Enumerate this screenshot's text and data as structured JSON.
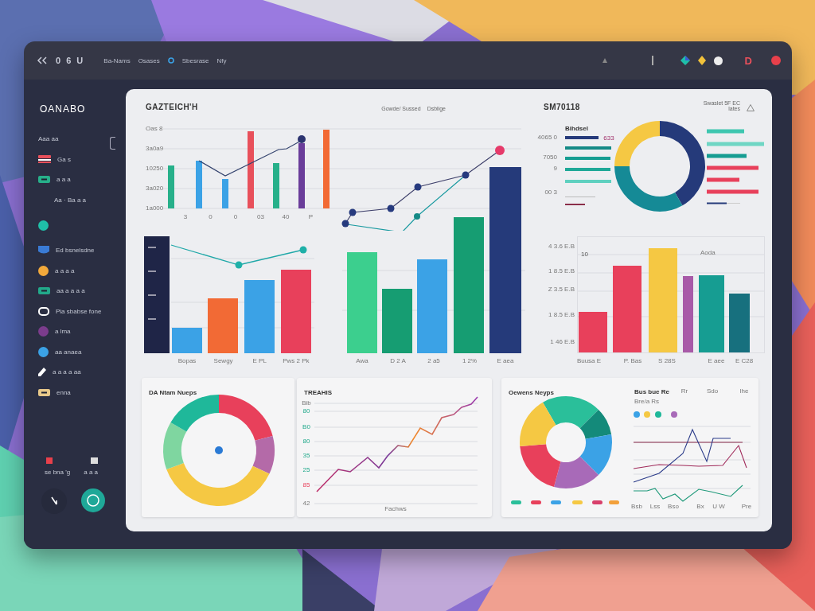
{
  "topbar": {
    "title": "0 6 U",
    "menu": [
      {
        "label": "Ba-Nams"
      },
      {
        "label": "Osases"
      },
      {
        "label": "Sbesrase"
      },
      {
        "label": "Nfy"
      }
    ],
    "avatar_letter": "D"
  },
  "sidebar": {
    "brand": "OANABO",
    "items": [
      {
        "label": "Aaa aa"
      },
      {
        "label": "Ga s",
        "kind": "stripes",
        "color": "#e8505b"
      },
      {
        "label": "a a a",
        "kind": "rect",
        "color": "#27b08a"
      },
      {
        "label": "Aa · Ba a a",
        "kind": "indent"
      },
      {
        "kind": "circle",
        "color": "#1fbfa8"
      },
      {
        "label": "Ed bsnelsdne",
        "kind": "shield",
        "color": "#3a7bd5"
      },
      {
        "label": "a a a a",
        "kind": "circle",
        "color": "#f2a93b"
      },
      {
        "label": "aa a a a a",
        "kind": "rect",
        "color": "#22a98a"
      },
      {
        "label": "Pia sbabse fone",
        "kind": "ring",
        "color": "#ffffff"
      },
      {
        "label": "a lma",
        "kind": "circle",
        "color": "#7b3c8c"
      },
      {
        "label": "aa anaea",
        "kind": "circle",
        "color": "#3ba2e6"
      },
      {
        "label": "a a a a aa",
        "kind": "pen",
        "color": "#ffffff"
      },
      {
        "label": "enna",
        "kind": "rect",
        "color": "#e8c98a"
      }
    ],
    "footer": [
      "se bna 'g",
      "a a a"
    ]
  },
  "top_chart": {
    "title": "GAZTEICH'H",
    "legend": [
      "Gowde/ Sussed",
      "Dsblige"
    ],
    "yticks": [
      "Oas 8",
      "3a0a9",
      "10250",
      "3a020",
      "1a000"
    ],
    "xlabels": [
      "3",
      "0",
      "0",
      "03",
      "40",
      "P"
    ]
  },
  "summary_card": {
    "title": "SM70118",
    "action": "Swaslet 5F EC",
    "action_note": "lates",
    "heading": "Bihdsel",
    "badge": "633",
    "labels": [
      "4065 0",
      "7050",
      "9",
      "00 3"
    ]
  },
  "middle_charts": [
    {
      "xlabels": [
        "Bopas",
        "Sewgy",
        "E PL",
        "Pws 2 Pk"
      ]
    },
    {
      "xlabels": [
        "Awa",
        "D 2 A",
        "2 a5",
        "1 2%",
        "E aea"
      ]
    },
    {
      "yticks": [
        "4 3.6 E.B",
        "1 8.5 E.B",
        "Z 3.5 E.B",
        "1 8.5 E.B",
        "1 46 E.B"
      ],
      "corner_labels": [
        "10",
        "Aoda"
      ],
      "xlabels": [
        "Buusa E",
        "P. Bas",
        "S 28S",
        "E aee",
        "E C28"
      ]
    }
  ],
  "bottom_cards": [
    {
      "kind": "donut",
      "title": "DA Ntam Nueps"
    },
    {
      "kind": "trend",
      "title": "TREAHIS",
      "yticks": [
        "Bib",
        "80",
        "B0",
        "80",
        "35",
        "25",
        "85",
        "42"
      ],
      "xlabel": "Fachws"
    },
    {
      "kind": "pie",
      "title": "Oewens Neyps",
      "side_title": "Bus bue Re",
      "side_subtitle": "Bre/a Rs",
      "side_tabs": [
        "Rr",
        "Sdo",
        "lhe"
      ],
      "xlabels": [
        "Bsb",
        "Lss",
        "Bso",
        "Bx",
        "U W",
        "Pre"
      ]
    }
  ]
}
